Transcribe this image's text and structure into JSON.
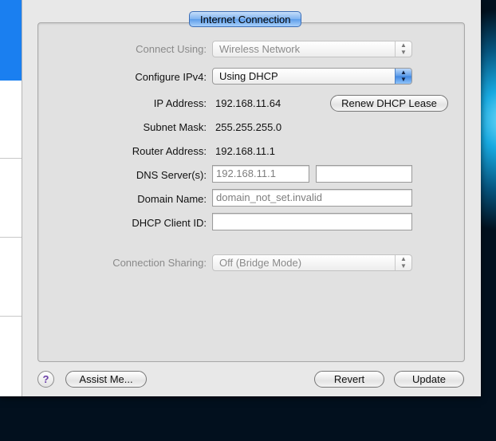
{
  "tab": {
    "label": "Internet Connection"
  },
  "connect_using": {
    "label": "Connect Using:",
    "value": "Wireless Network"
  },
  "configure_ipv4": {
    "label": "Configure IPv4:",
    "value": "Using DHCP"
  },
  "ip_address": {
    "label": "IP Address:",
    "value": "192.168.11.64"
  },
  "renew_button": "Renew DHCP Lease",
  "subnet_mask": {
    "label": "Subnet Mask:",
    "value": "255.255.255.0"
  },
  "router_address": {
    "label": "Router Address:",
    "value": "192.168.11.1"
  },
  "dns_servers": {
    "label": "DNS Server(s):",
    "placeholder": "192.168.11.1",
    "value2": ""
  },
  "domain_name": {
    "label": "Domain Name:",
    "placeholder": "domain_not_set.invalid"
  },
  "dhcp_client_id": {
    "label": "DHCP Client ID:",
    "value": ""
  },
  "connection_sharing": {
    "label": "Connection Sharing:",
    "value": "Off (Bridge Mode)"
  },
  "footer": {
    "help": "?",
    "assist_me": "Assist Me...",
    "revert": "Revert",
    "update": "Update"
  },
  "colors": {
    "accent": "#5d9de9",
    "sidebar_selection": "#1a7ff0"
  }
}
